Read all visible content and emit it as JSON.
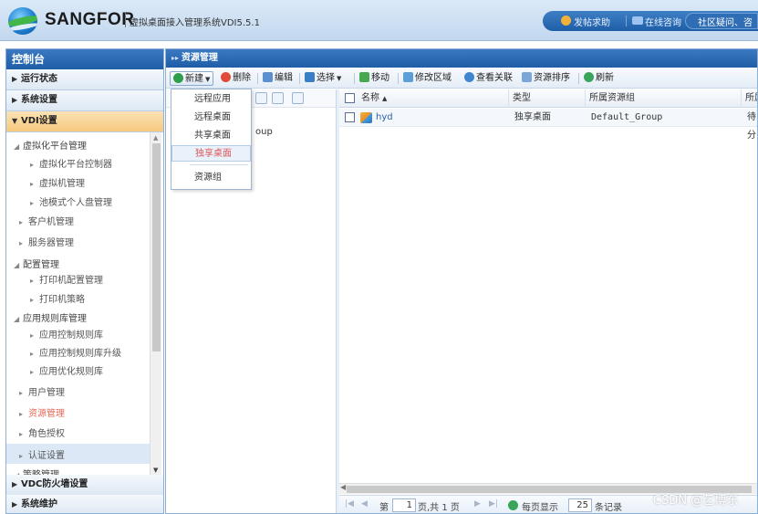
{
  "header": {
    "brand": "SANGFOR",
    "product": "虚拟桌面接入管理系统VDI5.5.1",
    "links": {
      "help": "发帖求助",
      "consult": "在线咨询",
      "community": "社区疑问、咨"
    }
  },
  "sidebar": {
    "title": "控制台",
    "sections": {
      "run_status": "运行状态",
      "system_settings": "系统设置",
      "vdi_settings": "VDI设置",
      "vdc_firewall": "VDC防火墙设置",
      "system_maintenance": "系统维护"
    },
    "tree": {
      "virt_platform_mgmt": "虚拟化平台管理",
      "virt_platform_controller": "虚拟化平台控制器",
      "vm_mgmt": "虚拟机管理",
      "pool_personal_disk": "池模式个人盘管理",
      "client_mgmt": "客户机管理",
      "server_mgmt": "服务器管理",
      "config_mgmt": "配置管理",
      "printer_config": "打印机配置管理",
      "printer_policy": "打印机策略",
      "app_rule_lib": "应用规则库管理",
      "app_control_lib": "应用控制规则库",
      "app_control_upgrade": "应用控制规则库升级",
      "app_optimize_lib": "应用优化规则库",
      "user_mgmt": "用户管理",
      "resource_mgmt": "资源管理",
      "role_auth": "角色授权",
      "auth_settings": "认证设置",
      "policy_mgmt": "策略管理"
    }
  },
  "main": {
    "title": "资源管理",
    "toolbar": {
      "new": "新建",
      "delete": "删除",
      "edit": "编辑",
      "select": "选择",
      "move": "移动",
      "modify_zone": "修改区域",
      "view_assoc": "查看关联",
      "resource_sort": "资源排序",
      "refresh": "刷新"
    },
    "new_menu": {
      "remote_app": "远程应用",
      "remote_desktop": "远程桌面",
      "shared_desktop": "共享桌面",
      "dedicated_desktop": "独享桌面",
      "resource_group": "资源组"
    },
    "subtree_item": "oup",
    "grid": {
      "columns": {
        "name": "名称",
        "type": "类型",
        "group": "所属资源组",
        "more": "所属"
      },
      "rows": [
        {
          "name": "hyd",
          "type": "独享桌面",
          "group": "Default_Group",
          "more": "待分"
        }
      ]
    },
    "pager": {
      "page_prefix": "第",
      "page_value": "1",
      "page_suffix": "页,共 1 页",
      "per_page_prefix": "每页显示",
      "per_page_value": "25",
      "per_page_suffix": "条记录"
    }
  },
  "watermark": "CSDN @艺博东",
  "colors": {
    "header_blue": "#1f5da7",
    "active_section": "#f6c97d",
    "highlight_red": "#e26a5a"
  }
}
